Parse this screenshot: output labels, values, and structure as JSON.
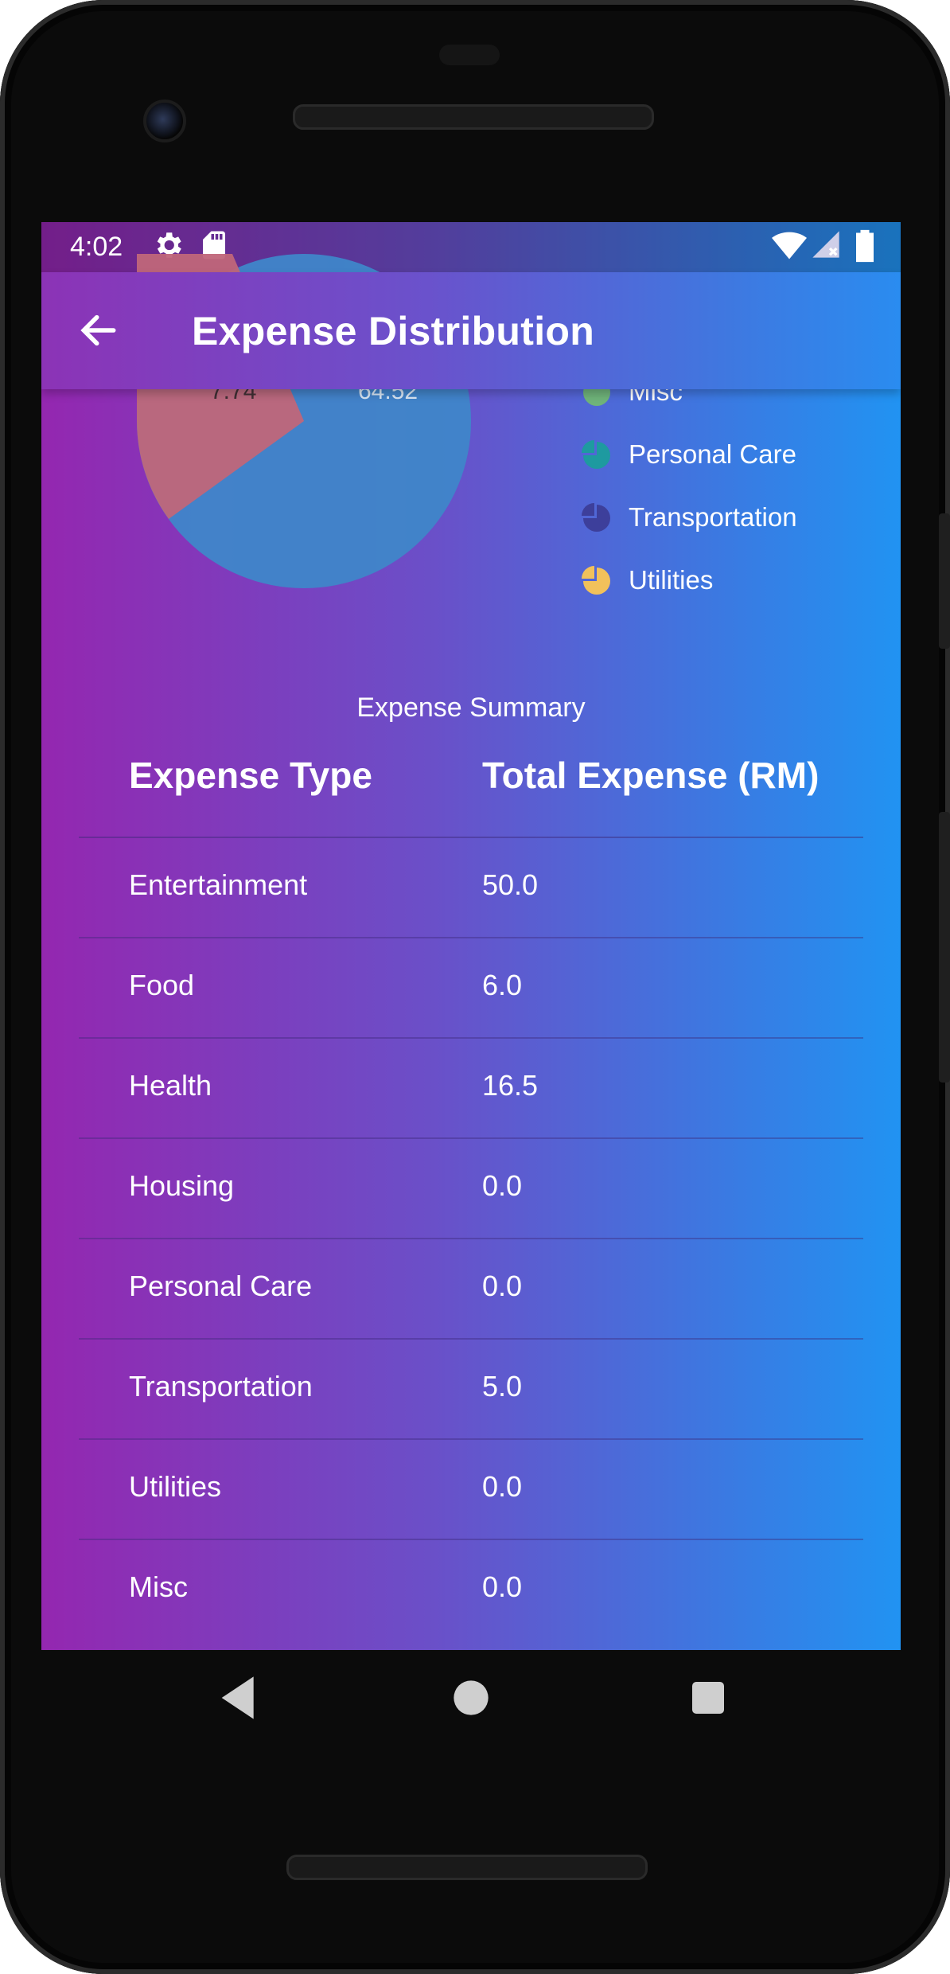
{
  "status_bar": {
    "time": "4:02",
    "icons": [
      "gear-icon",
      "sd-card-icon",
      "wifi-icon",
      "cell-signal-icon",
      "battery-icon"
    ]
  },
  "app_bar": {
    "title": "Expense Distribution",
    "back_icon": "arrow-back-icon"
  },
  "colors": {
    "gradient_start": "#9427b0",
    "gradient_end": "#2193f2",
    "misc": "#6fb37a",
    "personal_care": "#1e9aa0",
    "transportation": "#3d3f9b",
    "utilities": "#f1c15b",
    "pie_main": "#3f86c9",
    "pie_other": "#c0667a"
  },
  "chart_data": {
    "type": "pie",
    "visible_slice_labels": [
      "7.74",
      "64.52"
    ],
    "legend": [
      {
        "label": "Misc",
        "color": "#6fb37a"
      },
      {
        "label": "Personal Care",
        "color": "#1e9aa0"
      },
      {
        "label": "Transportation",
        "color": "#3d3f9b"
      },
      {
        "label": "Utilities",
        "color": "#f1c15b"
      }
    ]
  },
  "summary": {
    "caption": "Expense Summary",
    "headers": [
      "Expense Type",
      "Total Expense (RM)"
    ],
    "rows": [
      {
        "type": "Entertainment",
        "total": "50.0"
      },
      {
        "type": "Food",
        "total": "6.0"
      },
      {
        "type": "Health",
        "total": "16.5"
      },
      {
        "type": "Housing",
        "total": "0.0"
      },
      {
        "type": "Personal Care",
        "total": "0.0"
      },
      {
        "type": "Transportation",
        "total": "5.0"
      },
      {
        "type": "Utilities",
        "total": "0.0"
      },
      {
        "type": "Misc",
        "total": "0.0"
      }
    ]
  },
  "nav_bar": {
    "buttons": [
      "back-triangle-icon",
      "home-circle-icon",
      "recents-square-icon"
    ]
  }
}
